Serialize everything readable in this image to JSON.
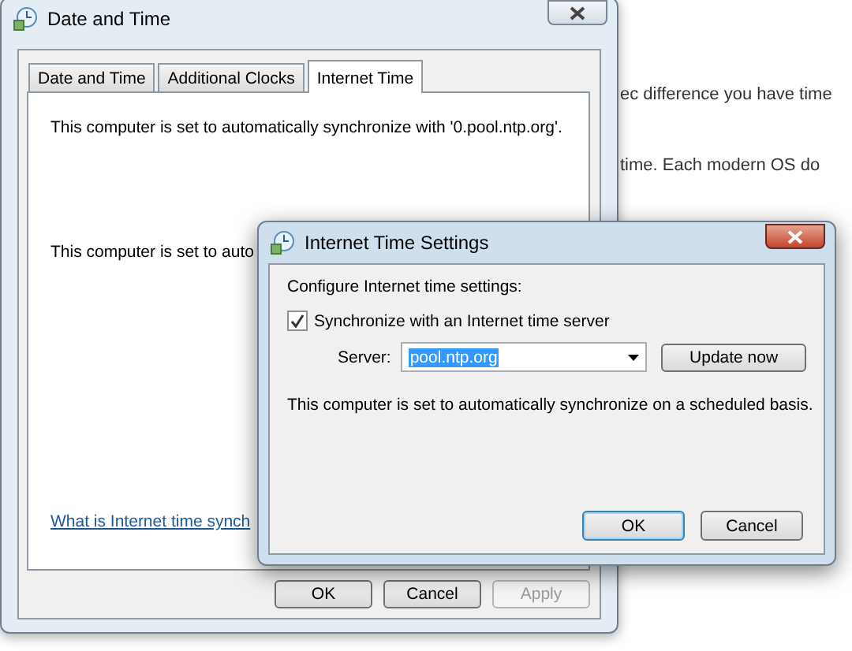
{
  "background_text": [
    "ec difference you have time",
    "time. Each modern OS do"
  ],
  "main_window": {
    "title": "Date and Time",
    "tabs": [
      {
        "label": "Date and Time",
        "selected": false
      },
      {
        "label": "Additional Clocks",
        "selected": false
      },
      {
        "label": "Internet Time",
        "selected": true
      }
    ],
    "messages": [
      "This computer is set to automatically synchronize with '0.pool.ntp.org'.",
      "This computer is set to auto"
    ],
    "link": "What is Internet time synch",
    "buttons": [
      {
        "label": "OK",
        "disabled": false
      },
      {
        "label": "Cancel",
        "disabled": false
      },
      {
        "label": "Apply",
        "disabled": true
      }
    ]
  },
  "dialog": {
    "title": "Internet Time Settings",
    "heading": "Configure Internet time settings:",
    "sync": {
      "label": "Synchronize with an Internet time server",
      "checked": true
    },
    "server": {
      "label": "Server:",
      "value": "pool.ntp.org",
      "highlighted": true
    },
    "update_button": "Update now",
    "status": "This computer is set to automatically synchronize on a scheduled basis.",
    "buttons": [
      {
        "label": "OK",
        "default": true
      },
      {
        "label": "Cancel",
        "default": false
      }
    ]
  }
}
